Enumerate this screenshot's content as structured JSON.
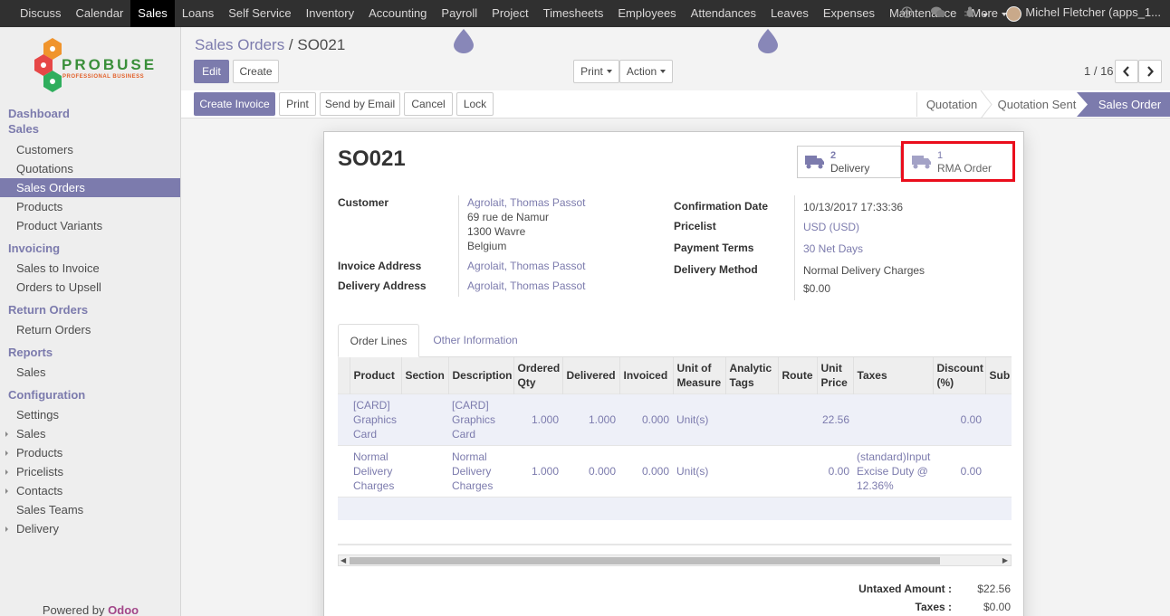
{
  "topbar": {
    "menu": [
      "Discuss",
      "Calendar",
      "Sales",
      "Loans",
      "Self Service",
      "Inventory",
      "Accounting",
      "Payroll",
      "Project",
      "Timesheets",
      "Employees",
      "Attendances",
      "Leaves",
      "Expenses",
      "Maintenance",
      "More"
    ],
    "active": "Sales",
    "user": "Michel Fletcher (apps_1..."
  },
  "logo": {
    "text": "PROBUSE",
    "sub": "PROFESSIONAL BUSINESS"
  },
  "sidebar": {
    "items": [
      {
        "label": "Dashboard",
        "type": "section"
      },
      {
        "label": "Sales",
        "type": "section"
      },
      {
        "label": "Customers",
        "type": "item"
      },
      {
        "label": "Quotations",
        "type": "item"
      },
      {
        "label": "Sales Orders",
        "type": "item",
        "active": true
      },
      {
        "label": "Products",
        "type": "item"
      },
      {
        "label": "Product Variants",
        "type": "item"
      },
      {
        "label": "Invoicing",
        "type": "section"
      },
      {
        "label": "Sales to Invoice",
        "type": "item"
      },
      {
        "label": "Orders to Upsell",
        "type": "item"
      },
      {
        "label": "Return Orders",
        "type": "section"
      },
      {
        "label": "Return Orders",
        "type": "item"
      },
      {
        "label": "Reports",
        "type": "section"
      },
      {
        "label": "Sales",
        "type": "item"
      },
      {
        "label": "Configuration",
        "type": "section"
      },
      {
        "label": "Settings",
        "type": "item"
      },
      {
        "label": "Sales",
        "type": "item",
        "expandable": true
      },
      {
        "label": "Products",
        "type": "item",
        "expandable": true
      },
      {
        "label": "Pricelists",
        "type": "item",
        "expandable": true
      },
      {
        "label": "Contacts",
        "type": "item",
        "expandable": true
      },
      {
        "label": "Sales Teams",
        "type": "item"
      },
      {
        "label": "Delivery",
        "type": "item",
        "expandable": true
      }
    ],
    "powered_prefix": "Powered by ",
    "powered_brand": "Odoo"
  },
  "breadcrumb": {
    "parent": "Sales Orders",
    "sep": " / ",
    "current": "SO021"
  },
  "buttons": {
    "edit": "Edit",
    "create": "Create",
    "print": "Print",
    "action": "Action",
    "create_invoice": "Create Invoice",
    "print2": "Print",
    "send_email": "Send by Email",
    "cancel": "Cancel",
    "lock": "Lock"
  },
  "pager": {
    "text": "1 / 16"
  },
  "stages": [
    "Quotation",
    "Quotation Sent",
    "Sales Order"
  ],
  "current_stage": "Sales Order",
  "record": {
    "name": "SO021",
    "smart_buttons": [
      {
        "count": "2",
        "label": "Delivery"
      },
      {
        "count": "1",
        "label": "RMA Order"
      }
    ],
    "customer_label": "Customer",
    "customer_name": "Agrolait, Thomas Passot",
    "customer_addr1": "69 rue de Namur",
    "customer_addr2": "1300 Wavre",
    "customer_addr3": "Belgium",
    "invoice_address_label": "Invoice Address",
    "invoice_address": "Agrolait, Thomas Passot",
    "delivery_address_label": "Delivery Address",
    "delivery_address": "Agrolait, Thomas Passot",
    "confirmation_date_label": "Confirmation Date",
    "confirmation_date": "10/13/2017 17:33:36",
    "pricelist_label": "Pricelist",
    "pricelist": "USD (USD)",
    "payment_terms_label": "Payment Terms",
    "payment_terms": "30 Net Days",
    "delivery_method_label": "Delivery Method",
    "delivery_method": "Normal Delivery Charges",
    "delivery_cost": "$0.00"
  },
  "tabs": [
    "Order Lines",
    "Other Information"
  ],
  "order_lines": {
    "columns": [
      "Product",
      "Section",
      "Description",
      "Ordered Qty",
      "Delivered",
      "Invoiced",
      "Unit of Measure",
      "Analytic Tags",
      "Route",
      "Unit Price",
      "Taxes",
      "Discount (%)",
      "Sub"
    ],
    "rows": [
      [
        "[CARD] Graphics Card",
        "",
        "[CARD] Graphics Card",
        "1.000",
        "1.000",
        "0.000",
        "Unit(s)",
        "",
        "",
        "22.56",
        "",
        "0.00",
        ""
      ],
      [
        "Normal Delivery Charges",
        "",
        "Normal Delivery Charges",
        "1.000",
        "0.000",
        "0.000",
        "Unit(s)",
        "",
        "",
        "0.00",
        "(standard)Input Excise Duty @ 12.36%",
        "0.00",
        ""
      ]
    ]
  },
  "totals": {
    "untaxed_label": "Untaxed Amount :",
    "untaxed": "$22.56",
    "taxes_label": "Taxes :",
    "taxes": "$0.00"
  },
  "colors": {
    "accent": "#7c7bad",
    "topbar": "#303030",
    "highlight": "#ea0d1c"
  }
}
